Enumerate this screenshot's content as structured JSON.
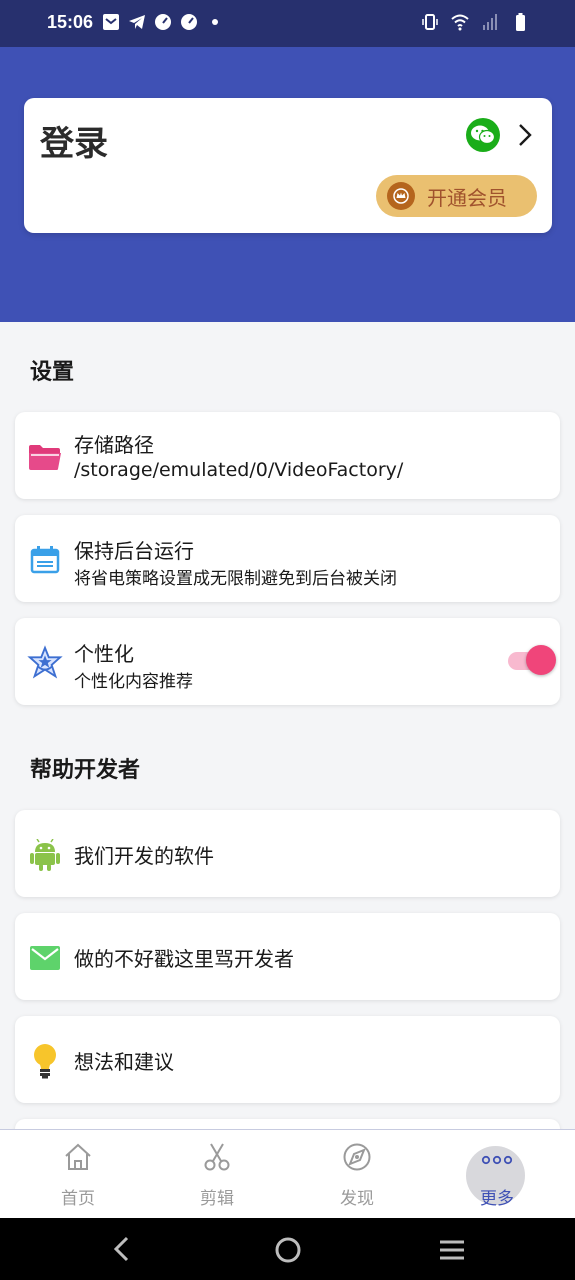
{
  "status_bar": {
    "time": "15:06",
    "left_icons": [
      "mail-icon",
      "telegram-icon",
      "speedometer-icon",
      "speedometer-icon",
      "dot-icon"
    ],
    "right_icons": [
      "vibrate-icon",
      "wifi-icon",
      "signal-icon",
      "battery-icon"
    ],
    "color": "#27306e"
  },
  "header": {
    "color": "#3f51b5",
    "login_title": "登录",
    "vip_label": "开通会员"
  },
  "settings": {
    "title": "设置",
    "items": [
      {
        "title": "存储路径",
        "subtitle": "/storage/emulated/0/VideoFactory/",
        "icon": "folder-icon"
      },
      {
        "title": "保持后台运行",
        "subtitle": "将省电策略设置成无限制避免到后台被关闭",
        "icon": "background-run-icon"
      },
      {
        "title": "个性化",
        "subtitle": "个性化内容推荐",
        "icon": "star-badge-icon",
        "toggle_on": true
      }
    ]
  },
  "help": {
    "title": "帮助开发者",
    "items": [
      {
        "title": "我们开发的软件",
        "icon": "android-icon"
      },
      {
        "title": "做的不好戳这里骂开发者",
        "icon": "mail-icon"
      },
      {
        "title": "想法和建议",
        "icon": "lightbulb-icon"
      }
    ]
  },
  "bottom_nav": {
    "items": [
      {
        "label": "首页",
        "icon": "home-icon"
      },
      {
        "label": "剪辑",
        "icon": "scissors-icon"
      },
      {
        "label": "发现",
        "icon": "compass-icon"
      },
      {
        "label": "更多",
        "icon": "more-icon",
        "active": true
      }
    ],
    "active_color": "#3f51b5"
  },
  "system_nav": {
    "buttons": [
      "back-icon",
      "home-circle-icon",
      "recents-icon"
    ]
  }
}
